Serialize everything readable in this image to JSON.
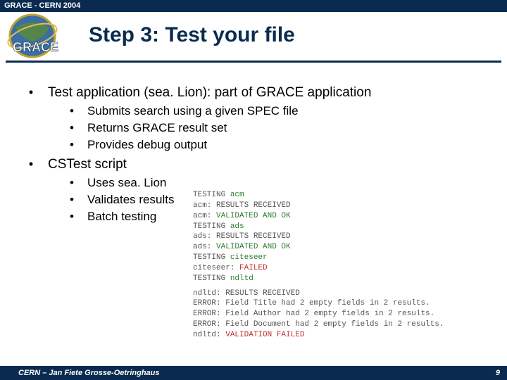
{
  "top_bar": "GRACE - CERN 2004",
  "title": "Step 3: Test your file",
  "bullets": {
    "b1": "Test application (sea. Lion): part of GRACE application",
    "b1a": "Submits search using a given SPEC file",
    "b1b": "Returns GRACE result set",
    "b1c": "Provides debug output",
    "b2": "CSTest script",
    "b2a": "Uses sea. Lion",
    "b2b": "Validates results",
    "b2c": "Batch testing"
  },
  "term": {
    "l01a": "TESTING ",
    "l01b": "acm",
    "l02": "acm: RESULTS RECEIVED",
    "l03a": "acm: ",
    "l03b": "VALIDATED AND OK",
    "l04a": "TESTING ",
    "l04b": "ads",
    "l05": "ads: RESULTS RECEIVED",
    "l06a": "ads: ",
    "l06b": "VALIDATED AND OK",
    "l07a": "TESTING ",
    "l07b": "citeseer",
    "l08a": "citeseer: ",
    "l08b": "FAILED",
    "l09a": "TESTING ",
    "l09b": "ndltd",
    "l11": "ndltd: RESULTS RECEIVED",
    "l12": "ERROR: Field Title had 2 empty fields in 2 results.",
    "l13": "ERROR: Field Author had 2 empty fields in 2 results.",
    "l14": "ERROR: Field Document had 2 empty fields in 2 results.",
    "l15a": "ndltd: ",
    "l15b": "VALIDATION FAILED"
  },
  "footer": {
    "text": "CERN – Jan Fiete Grosse-Oetringhaus",
    "page": "9"
  },
  "colors": {
    "brand": "#0a2b4f",
    "term_green": "#2e7d2e",
    "term_red": "#c03030"
  }
}
